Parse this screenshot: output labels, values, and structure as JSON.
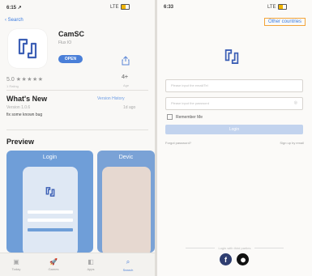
{
  "left": {
    "status": {
      "time": "6:15 ↗",
      "right": "LTE"
    },
    "nav": {
      "back_label": "Search"
    },
    "app": {
      "name": "CamSC",
      "subtitle": "Flux IO",
      "open_label": "OPEN",
      "logo_icon": "camsc-logo-icon",
      "share_icon": "share-icon"
    },
    "rating": {
      "value": "5.0",
      "stars": "★★★★★",
      "count": "1 Rating"
    },
    "age": {
      "value": "4+",
      "label": "Age"
    },
    "whats_new": {
      "title": "What's New",
      "history_label": "Version History",
      "version": "Version 1.0.6",
      "ago": "1d ago",
      "notes": "fix some known bug"
    },
    "preview": {
      "title": "Preview",
      "shot1_title": "Login",
      "shot2_title": "Devic"
    },
    "tabbar": [
      {
        "icon": "today-icon",
        "glyph": "▣",
        "label": "Today"
      },
      {
        "icon": "games-icon",
        "glyph": "🚀",
        "label": "Games"
      },
      {
        "icon": "apps-icon",
        "glyph": "◧",
        "label": "Apps"
      },
      {
        "icon": "search-icon",
        "glyph": "⌕",
        "label": "Search"
      }
    ]
  },
  "right": {
    "status": {
      "time": "6:33",
      "right": "LTE"
    },
    "other_countries": "Other countries",
    "fields": [
      {
        "placeholder": "Please input the email/Tel"
      },
      {
        "placeholder": "Please input the password"
      }
    ],
    "remember": "Remember Me",
    "login_label": "Login",
    "forgot": "Forgot password?",
    "signup": "Sign up by email",
    "or_label": "Login with third parties",
    "social": [
      {
        "icon": "facebook-icon",
        "glyph": "f"
      },
      {
        "icon": "apple-icon",
        "glyph": ""
      }
    ]
  },
  "colors": {
    "accent": "#4a7fd8",
    "link": "#3a7be0",
    "highlight_border": "#f2a43a"
  }
}
